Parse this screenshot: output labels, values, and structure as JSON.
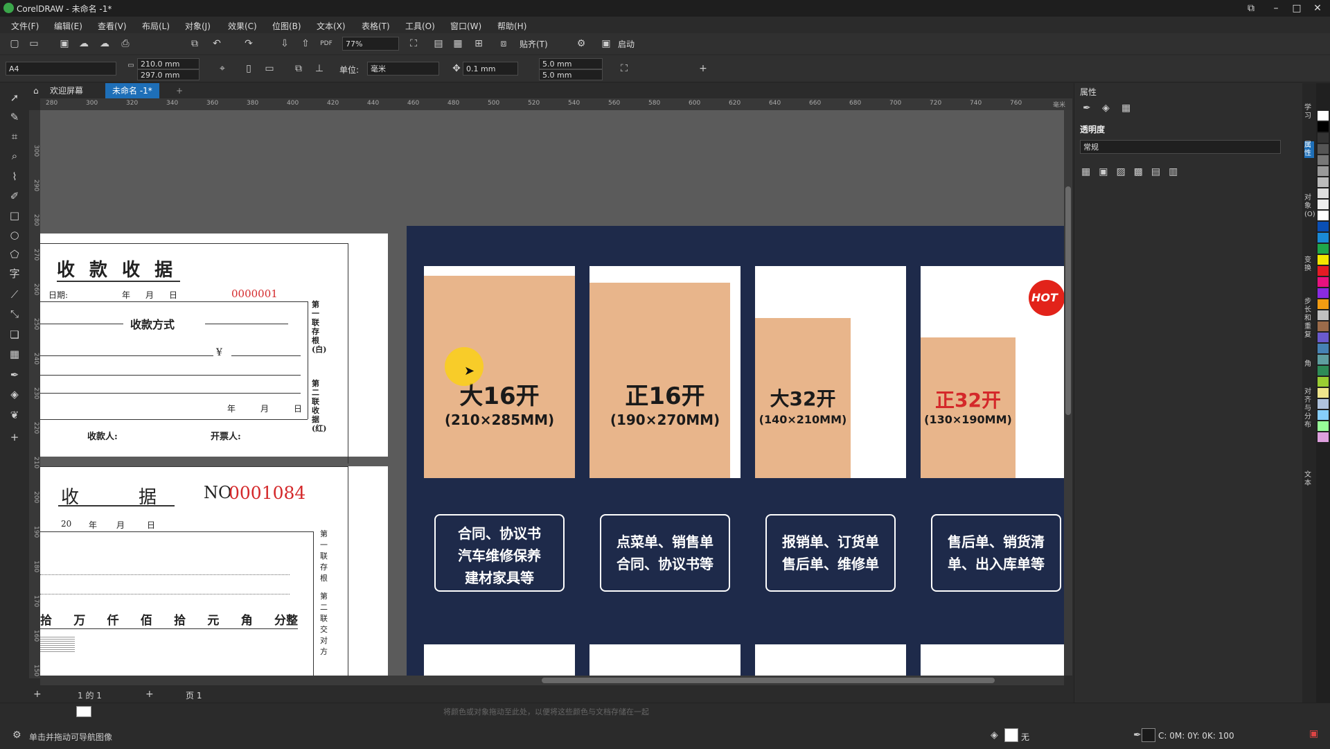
{
  "window": {
    "title": "CorelDRAW - 未命名 -1*"
  },
  "menu": [
    "文件(F)",
    "编辑(E)",
    "查看(V)",
    "布局(L)",
    "对象(J)",
    "效果(C)",
    "位图(B)",
    "文本(X)",
    "表格(T)",
    "工具(O)",
    "窗口(W)",
    "帮助(H)"
  ],
  "toolbar": {
    "zoom": "77%",
    "snap_label": "贴齐(T)",
    "launch_label": "启动"
  },
  "propbar": {
    "page_size": "A4",
    "width": "210.0 mm",
    "height": "297.0 mm",
    "unit_label": "单位:",
    "unit_value": "毫米",
    "nudge": "0.1 mm",
    "dup_x": "5.0 mm",
    "dup_y": "5.0 mm"
  },
  "tabs": {
    "welcome": "欢迎屏幕",
    "doc": "未命名 -1*"
  },
  "ruler_h": [
    "280",
    "300",
    "320",
    "340",
    "360",
    "380",
    "400",
    "420",
    "440",
    "460",
    "480",
    "500",
    "520",
    "540",
    "560",
    "580",
    "600",
    "620",
    "640",
    "660",
    "680",
    "700",
    "720",
    "740",
    "760"
  ],
  "ruler_h_unit": "毫米",
  "ruler_v": [
    "300",
    "290",
    "280",
    "270",
    "260",
    "250",
    "240",
    "230",
    "220",
    "210",
    "200",
    "190",
    "180",
    "170",
    "160",
    "150"
  ],
  "receipt1": {
    "title": "收 款 收 据",
    "date_label": "日期:",
    "year": "年",
    "month": "月",
    "day": "日",
    "number": "0000001",
    "pay_method": "收款方式",
    "yen": "¥",
    "payee": "收款人:",
    "drawer": "开票人:",
    "side1": "第一联存根(白)",
    "side2": "第二联收据(红)"
  },
  "receipt2": {
    "title_a": "收",
    "title_b": "据",
    "no_label": "NO",
    "number": "0001084",
    "year_prefix": "20",
    "year": "年",
    "month": "月",
    "day": "日",
    "amount_units": [
      "拾",
      "万",
      "仟",
      "佰",
      "拾",
      "元",
      "角",
      "分整"
    ],
    "side1": "第一联存根",
    "side2": "第二联交对方"
  },
  "cards": [
    {
      "title": "大16开",
      "size": "(210×285MM)",
      "uses": [
        "合同、协议书",
        "汽车维修保养",
        "建材家具等"
      ]
    },
    {
      "title": "正16开",
      "size": "(190×270MM)",
      "uses": [
        "点菜单、销售单",
        "合同、协议书等"
      ]
    },
    {
      "title": "大32开",
      "size": "(140×210MM)",
      "uses": [
        "报销单、订货单",
        "售后单、维修单"
      ]
    },
    {
      "title": "正32开",
      "size": "(130×190MM)",
      "uses": [
        "售后单、销货清",
        "单、出入库单等"
      ],
      "hot": "HOT"
    }
  ],
  "colors": {
    "title_red": "#d4282a",
    "banner": "#1e2a4a",
    "tan": "#e8b58b"
  },
  "pagebar": {
    "page_of": "1 的 1",
    "page_tab": "页 1"
  },
  "status": {
    "hint": "将颜色或对象拖动至此处，以便将这些颜色与文档存储在一起",
    "left_hint": "单击并拖动可导航图像",
    "fill_label": "无",
    "outline_color": "C: 0M: 0Y: 0K: 100"
  },
  "properties": {
    "title": "属性",
    "section": "透明度",
    "mode": "常规"
  },
  "docker_tabs": [
    "学习",
    "属性",
    "对象(O)",
    "变换",
    "步长和重复",
    "角",
    "对齐与分布",
    "文本"
  ],
  "palette": [
    "#ffffff",
    "#000000",
    "#333333",
    "#555555",
    "#777777",
    "#999999",
    "#bbbbbb",
    "#dddddd",
    "#eeeeee",
    "#ffffff",
    "#0a4fb5",
    "#1a8ad6",
    "#1fa74a",
    "#f3e600",
    "#e51b24",
    "#e8117f",
    "#8a2be2",
    "#f39c12",
    "#c0c0c0",
    "#9b6b4a",
    "#6a5acd",
    "#4682b4",
    "#5f9ea0",
    "#2e8b57",
    "#9acd32",
    "#f0e68c",
    "#b0c4de",
    "#87cefa",
    "#98fb98",
    "#dda0dd"
  ]
}
